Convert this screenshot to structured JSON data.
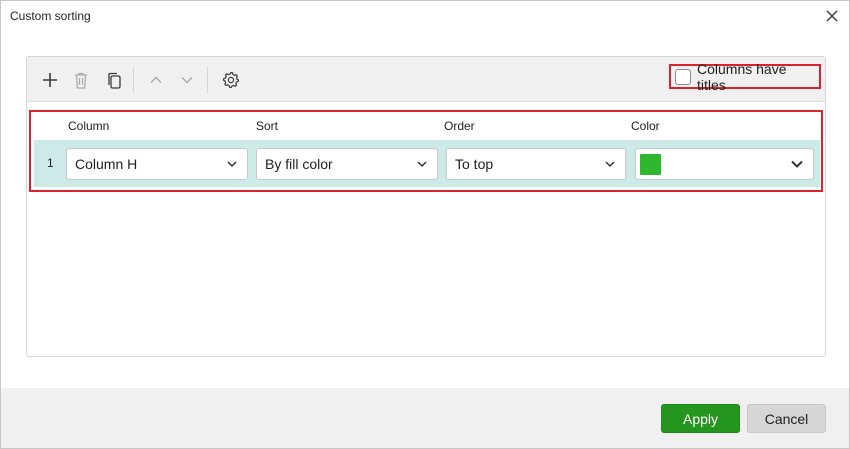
{
  "window": {
    "title": "Custom sorting"
  },
  "toolbar": {
    "icons": [
      "plus-icon",
      "trash-icon",
      "copy-icon",
      "chevron-up-icon",
      "chevron-down-icon",
      "gear-icon"
    ],
    "columns_have_titles_label": "Columns have titles",
    "columns_have_titles_checked": false
  },
  "table": {
    "headers": {
      "column": "Column",
      "sort": "Sort",
      "order": "Order",
      "color": "Color"
    },
    "rows": [
      {
        "index": "1",
        "column": "Column H",
        "sort": "By fill color",
        "order": "To top",
        "color": "#2fb82f"
      }
    ]
  },
  "footer": {
    "apply_label": "Apply",
    "cancel_label": "Cancel"
  },
  "colors": {
    "accent": "#24951e",
    "highlight": "#d9232e",
    "row_bg": "#cdebe6"
  }
}
